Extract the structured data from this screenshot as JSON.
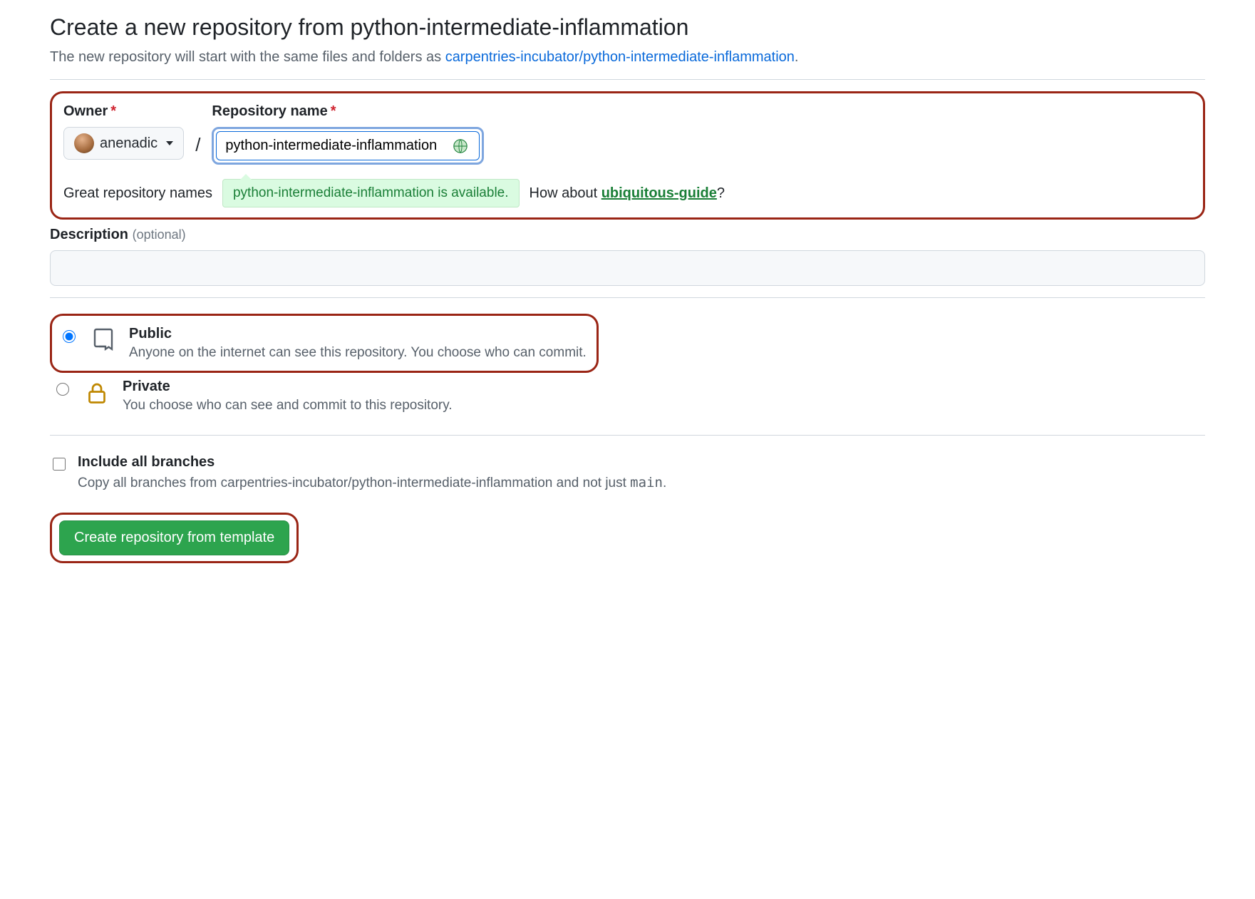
{
  "header": {
    "title": "Create a new repository from python-intermediate-inflammation",
    "subhead_prefix": "The new repository will start with the same files and folders as ",
    "template_link": "carpentries-incubator/python-intermediate-inflammation",
    "subhead_suffix": "."
  },
  "form": {
    "owner_label": "Owner",
    "repo_label": "Repository name",
    "required_marker": "*",
    "owner_name": "anenadic",
    "slash": "/",
    "repo_name_value": "python-intermediate-inflammation",
    "hint_prefix": "Great repository names",
    "availability_msg": "python-intermediate-inflammation is available.",
    "hint_about": "How about ",
    "suggested_name": "ubiquitous-guide",
    "hint_q": "?",
    "description_label": "Description",
    "optional_label": "(optional)",
    "description_value": ""
  },
  "visibility": {
    "public": {
      "title": "Public",
      "desc": "Anyone on the internet can see this repository. You choose who can commit."
    },
    "private": {
      "title": "Private",
      "desc": "You choose who can see and commit to this repository."
    }
  },
  "branches": {
    "title": "Include all branches",
    "desc_prefix": "Copy all branches from carpentries-incubator/python-intermediate-inflammation and not just ",
    "main_branch": "main",
    "desc_suffix": "."
  },
  "submit": {
    "label": "Create repository from template"
  },
  "colors": {
    "link": "#0969da",
    "success": "#1a7f37",
    "danger_border": "#9a2515",
    "btn_primary": "#2da44e"
  }
}
